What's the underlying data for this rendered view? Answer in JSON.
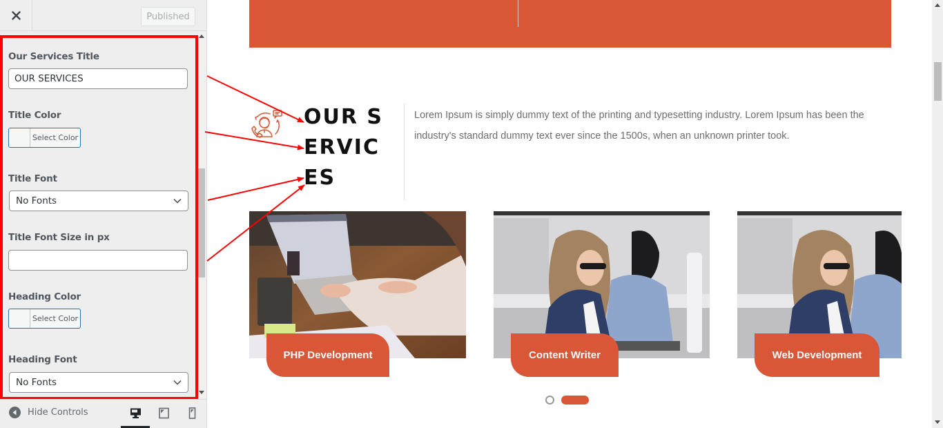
{
  "header": {
    "close_icon": "close-icon",
    "publish_button": "Published"
  },
  "controls": [
    {
      "type": "text",
      "label": "Our Services Title",
      "value": "OUR SERVICES",
      "placeholder": ""
    },
    {
      "type": "color",
      "label": "Title Color",
      "button": "Select Color"
    },
    {
      "type": "select",
      "label": "Title Font",
      "selected": "No Fonts"
    },
    {
      "type": "text",
      "label": "Title Font Size in px",
      "value": "",
      "placeholder": ""
    },
    {
      "type": "color",
      "label": "Heading Color",
      "button": "Select Color"
    },
    {
      "type": "select",
      "label": "Heading Font",
      "selected": "No Fonts"
    }
  ],
  "footer": {
    "hide_controls": "Hide Controls",
    "devices": [
      "desktop",
      "tablet",
      "mobile"
    ],
    "active_device": "desktop"
  },
  "preview": {
    "banner_color": "#d95637",
    "services_icon": "customer-support-icon",
    "services_title": "OUR SERVICES",
    "services_description": "Lorem Ipsum is simply dummy text of the printing and typesetting industry. Lorem Ipsum has been the industry's standard dummy text ever since the 1500s, when an unknown printer took.",
    "cards": [
      {
        "label": "PHP Development",
        "image": "woman-typing-on-laptop-photo"
      },
      {
        "label": "Content Writer",
        "image": "woman-with-glasses-at-desk-photo"
      },
      {
        "label": "Web Development",
        "image": "woman-with-glasses-at-desk-photo"
      }
    ],
    "carousel": {
      "pages": 2,
      "active_page": 2
    }
  },
  "colors": {
    "accent": "#d95637",
    "annotation": "#ff0000",
    "link_border": "#2271b1"
  }
}
